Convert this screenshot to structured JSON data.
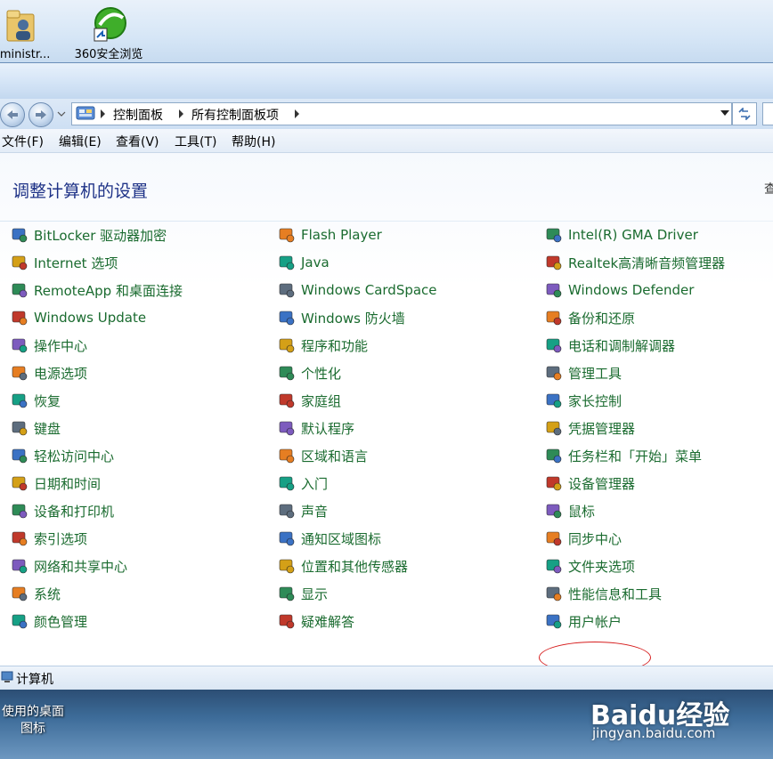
{
  "desktop": {
    "top_icons": [
      {
        "label": "dministr...",
        "icon": "user-folder-icon"
      },
      {
        "label": "360安全浏览",
        "icon": "browser-360-icon"
      }
    ],
    "bottom_icon_label_line1": "使用的桌面",
    "bottom_icon_label_line2": "图标",
    "watermark_logo": "Baidu经验",
    "watermark_url": "jingyan.baidu.com"
  },
  "addressbar": {
    "crumbs": [
      "控制面板",
      "所有控制面板项"
    ]
  },
  "menubar": {
    "items": [
      "文件(F)",
      "编辑(E)",
      "查看(V)",
      "工具(T)",
      "帮助(H)"
    ]
  },
  "main": {
    "heading": "调整计算机的设置",
    "view_stub": "查"
  },
  "columns": [
    [
      {
        "label": "BitLocker 驱动器加密",
        "icon": "bitlocker-icon"
      },
      {
        "label": "Internet 选项",
        "icon": "internet-options-icon"
      },
      {
        "label": "RemoteApp 和桌面连接",
        "icon": "remoteapp-icon"
      },
      {
        "label": "Windows Update",
        "icon": "windows-update-icon"
      },
      {
        "label": "操作中心",
        "icon": "action-center-flag-icon"
      },
      {
        "label": "电源选项",
        "icon": "power-options-icon"
      },
      {
        "label": "恢复",
        "icon": "recovery-icon"
      },
      {
        "label": "键盘",
        "icon": "keyboard-icon"
      },
      {
        "label": "轻松访问中心",
        "icon": "ease-of-access-icon"
      },
      {
        "label": "日期和时间",
        "icon": "date-time-icon"
      },
      {
        "label": "设备和打印机",
        "icon": "devices-printers-icon"
      },
      {
        "label": "索引选项",
        "icon": "indexing-icon"
      },
      {
        "label": "网络和共享中心",
        "icon": "network-sharing-icon"
      },
      {
        "label": "系统",
        "icon": "system-icon"
      },
      {
        "label": "颜色管理",
        "icon": "color-management-icon"
      }
    ],
    [
      {
        "label": "Flash Player",
        "icon": "flash-player-icon"
      },
      {
        "label": "Java",
        "icon": "java-icon"
      },
      {
        "label": "Windows CardSpace",
        "icon": "cardspace-icon"
      },
      {
        "label": "Windows 防火墙",
        "icon": "firewall-icon"
      },
      {
        "label": "程序和功能",
        "icon": "programs-features-icon"
      },
      {
        "label": "个性化",
        "icon": "personalization-icon"
      },
      {
        "label": "家庭组",
        "icon": "homegroup-icon"
      },
      {
        "label": "默认程序",
        "icon": "default-programs-icon"
      },
      {
        "label": "区域和语言",
        "icon": "region-language-icon"
      },
      {
        "label": "入门",
        "icon": "getting-started-icon"
      },
      {
        "label": "声音",
        "icon": "sound-icon"
      },
      {
        "label": "通知区域图标",
        "icon": "notification-icons-icon"
      },
      {
        "label": "位置和其他传感器",
        "icon": "location-sensors-icon"
      },
      {
        "label": "显示",
        "icon": "display-icon"
      },
      {
        "label": "疑难解答",
        "icon": "troubleshooting-icon"
      }
    ],
    [
      {
        "label": "Intel(R) GMA Driver",
        "icon": "intel-gma-icon"
      },
      {
        "label": "Realtek高清晰音频管理器",
        "icon": "realtek-audio-icon"
      },
      {
        "label": "Windows Defender",
        "icon": "windows-defender-icon"
      },
      {
        "label": "备份和还原",
        "icon": "backup-restore-icon"
      },
      {
        "label": "电话和调制解调器",
        "icon": "phone-modem-icon"
      },
      {
        "label": "管理工具",
        "icon": "admin-tools-icon"
      },
      {
        "label": "家长控制",
        "icon": "parental-controls-icon"
      },
      {
        "label": "凭据管理器",
        "icon": "credential-manager-icon"
      },
      {
        "label": "任务栏和「开始」菜单",
        "icon": "taskbar-start-icon"
      },
      {
        "label": "设备管理器",
        "icon": "device-manager-icon"
      },
      {
        "label": "鼠标",
        "icon": "mouse-icon"
      },
      {
        "label": "同步中心",
        "icon": "sync-center-icon"
      },
      {
        "label": "文件夹选项",
        "icon": "folder-options-icon"
      },
      {
        "label": "性能信息和工具",
        "icon": "performance-icon"
      },
      {
        "label": "用户帐户",
        "icon": "user-accounts-icon"
      }
    ]
  ],
  "statusbar": {
    "text": "计算机"
  },
  "colors": {
    "link_green": "#1a6b2f",
    "heading_blue": "#1e3287",
    "highlight_red": "#d61e1e"
  }
}
